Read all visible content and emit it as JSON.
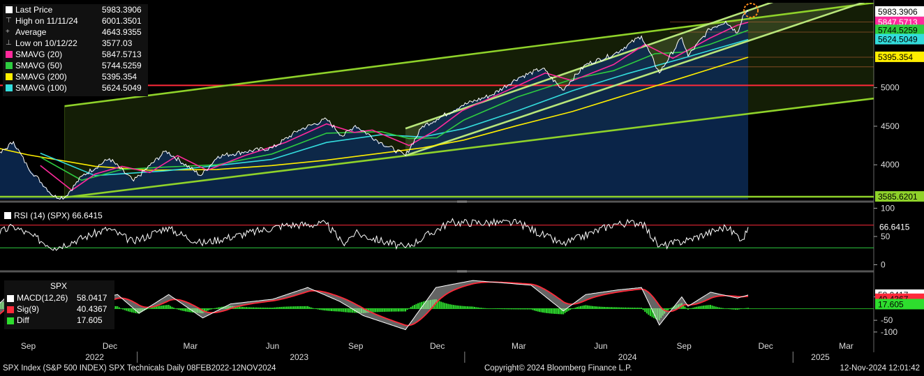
{
  "chart_data": {
    "type": "line",
    "title": "SPX Index (S&P 500 INDEX) SPX Technicals",
    "date_range": "Daily 08FEB2022-12NOV2024",
    "x_ticks": [
      "Sep",
      "Dec",
      "Mar",
      "Jun",
      "Sep",
      "Dec",
      "Mar",
      "Jun",
      "Sep",
      "Dec",
      "Mar"
    ],
    "x_years": [
      "2022",
      "2023",
      "2024",
      "2025"
    ],
    "price_panel": {
      "y_ticks": [
        "5000",
        "4500",
        "4000"
      ],
      "ylim": [
        3550,
        6100
      ],
      "legend": [
        {
          "label": "Last Price",
          "value": "5983.3906",
          "color": "#ffffff"
        },
        {
          "label": "High on 11/11/24",
          "value": "6001.3501",
          "color": "#bbbbbb"
        },
        {
          "label": "Average",
          "value": "4643.9355",
          "color": "#bbbbbb"
        },
        {
          "label": "Low on 10/12/22",
          "value": "3577.03",
          "color": "#bbbbbb"
        },
        {
          "label": "SMAVG (20)",
          "value": "5847.5713",
          "color": "#ff2a9c"
        },
        {
          "label": "SMAVG (50)",
          "value": "5744.5259",
          "color": "#2ecc40"
        },
        {
          "label": "SMAVG (200)",
          "value": "5395.354",
          "color": "#ffee00"
        },
        {
          "label": "SMAVG (100)",
          "value": "5624.5049",
          "color": "#33dddd"
        }
      ],
      "right_labels": [
        {
          "text": "5983.3906",
          "value": 5983.3906,
          "bg": "#ffffff",
          "fg": "#000000"
        },
        {
          "text": "5847.5713",
          "value": 5847.5713,
          "bg": "#ff2a9c",
          "fg": "#ffffff"
        },
        {
          "text": "5744.5259",
          "value": 5744.5259,
          "bg": "#2ecc40",
          "fg": "#000000"
        },
        {
          "text": "5624.5049",
          "value": 5624.5049,
          "bg": "#33dddd",
          "fg": "#000000"
        },
        {
          "text": "5395.354",
          "value": 5395.354,
          "bg": "#ffee00",
          "fg": "#000000"
        },
        {
          "text": "3585.6201",
          "value": 3585.6201,
          "bg": "#8fd22a",
          "fg": "#000000"
        }
      ],
      "horizontal_levels": [
        {
          "value": 5030,
          "color": "#ff2a3a"
        },
        {
          "value": 3585.6201,
          "color": "#8fd22a"
        }
      ],
      "series": [
        {
          "name": "Last Price",
          "color": "#ffffff",
          "points": [
            [
              "2022-02-08",
              4520
            ],
            [
              "2022-03-01",
              4300
            ],
            [
              "2022-04-01",
              4540
            ],
            [
              "2022-05-01",
              4150
            ],
            [
              "2022-05-20",
              3900
            ],
            [
              "2022-06-16",
              3670
            ],
            [
              "2022-07-01",
              3820
            ],
            [
              "2022-08-16",
              4300
            ],
            [
              "2022-09-01",
              3970
            ],
            [
              "2022-09-30",
              3590
            ],
            [
              "2022-10-12",
              3577
            ],
            [
              "2022-11-01",
              3860
            ],
            [
              "2022-12-01",
              4080
            ],
            [
              "2022-12-28",
              3790
            ],
            [
              "2023-01-15",
              3990
            ],
            [
              "2023-02-02",
              4180
            ],
            [
              "2023-03-13",
              3860
            ],
            [
              "2023-04-01",
              4110
            ],
            [
              "2023-05-01",
              4170
            ],
            [
              "2023-06-01",
              4220
            ],
            [
              "2023-06-30",
              4450
            ],
            [
              "2023-07-31",
              4590
            ],
            [
              "2023-08-18",
              4370
            ],
            [
              "2023-09-01",
              4510
            ],
            [
              "2023-09-29",
              4290
            ],
            [
              "2023-10-27",
              4120
            ],
            [
              "2023-11-15",
              4500
            ],
            [
              "2023-12-01",
              4590
            ],
            [
              "2023-12-29",
              4770
            ],
            [
              "2024-02-01",
              4910
            ],
            [
              "2024-03-01",
              5130
            ],
            [
              "2024-03-28",
              5250
            ],
            [
              "2024-04-19",
              4970
            ],
            [
              "2024-05-15",
              5300
            ],
            [
              "2024-06-15",
              5430
            ],
            [
              "2024-07-16",
              5670
            ],
            [
              "2024-08-05",
              5190
            ],
            [
              "2024-08-30",
              5650
            ],
            [
              "2024-09-06",
              5410
            ],
            [
              "2024-09-30",
              5760
            ],
            [
              "2024-10-18",
              5860
            ],
            [
              "2024-10-31",
              5710
            ],
            [
              "2024-11-06",
              5930
            ],
            [
              "2024-11-11",
              6001
            ],
            [
              "2024-11-12",
              5983
            ]
          ]
        },
        {
          "name": "SMAVG (20)",
          "color": "#ff2a9c",
          "points": [
            [
              "2022-09-15",
              3990
            ],
            [
              "2022-10-20",
              3670
            ],
            [
              "2022-11-15",
              3880
            ],
            [
              "2022-12-15",
              3980
            ],
            [
              "2023-01-15",
              3900
            ],
            [
              "2023-02-15",
              4120
            ],
            [
              "2023-03-20",
              3930
            ],
            [
              "2023-05-01",
              4120
            ],
            [
              "2023-06-15",
              4290
            ],
            [
              "2023-07-31",
              4530
            ],
            [
              "2023-08-31",
              4420
            ],
            [
              "2023-09-20",
              4450
            ],
            [
              "2023-10-31",
              4250
            ],
            [
              "2023-11-30",
              4450
            ],
            [
              "2023-12-29",
              4700
            ],
            [
              "2024-02-15",
              4950
            ],
            [
              "2024-03-31",
              5190
            ],
            [
              "2024-04-30",
              5090
            ],
            [
              "2024-06-15",
              5300
            ],
            [
              "2024-07-20",
              5560
            ],
            [
              "2024-08-20",
              5380
            ],
            [
              "2024-09-30",
              5640
            ],
            [
              "2024-10-31",
              5810
            ],
            [
              "2024-11-12",
              5847
            ]
          ]
        },
        {
          "name": "SMAVG (50)",
          "color": "#2ecc40",
          "points": [
            [
              "2022-09-15",
              4100
            ],
            [
              "2022-10-31",
              3800
            ],
            [
              "2022-12-15",
              3940
            ],
            [
              "2023-01-31",
              3970
            ],
            [
              "2023-03-31",
              4000
            ],
            [
              "2023-05-31",
              4140
            ],
            [
              "2023-07-31",
              4410
            ],
            [
              "2023-09-30",
              4430
            ],
            [
              "2023-10-31",
              4340
            ],
            [
              "2023-12-01",
              4350
            ],
            [
              "2023-12-31",
              4580
            ],
            [
              "2024-02-29",
              4880
            ],
            [
              "2024-04-30",
              5110
            ],
            [
              "2024-06-15",
              5220
            ],
            [
              "2024-07-31",
              5440
            ],
            [
              "2024-08-31",
              5460
            ],
            [
              "2024-09-30",
              5560
            ],
            [
              "2024-11-12",
              5744
            ]
          ]
        },
        {
          "name": "SMAVG (100)",
          "color": "#33dddd",
          "points": [
            [
              "2022-09-15",
              4150
            ],
            [
              "2022-11-15",
              3860
            ],
            [
              "2023-01-31",
              3920
            ],
            [
              "2023-03-31",
              3990
            ],
            [
              "2023-05-31",
              4070
            ],
            [
              "2023-07-31",
              4290
            ],
            [
              "2023-09-30",
              4390
            ],
            [
              "2023-11-15",
              4360
            ],
            [
              "2023-12-31",
              4470
            ],
            [
              "2024-02-29",
              4700
            ],
            [
              "2024-04-30",
              4960
            ],
            [
              "2024-06-30",
              5180
            ],
            [
              "2024-08-31",
              5380
            ],
            [
              "2024-11-12",
              5624
            ]
          ]
        },
        {
          "name": "SMAVG (200)",
          "color": "#ffee00",
          "points": [
            [
              "2022-02-08",
              4510
            ],
            [
              "2022-05-01",
              4450
            ],
            [
              "2022-07-01",
              4290
            ],
            [
              "2022-09-01",
              4130
            ],
            [
              "2022-11-15",
              3980
            ],
            [
              "2023-01-15",
              3930
            ],
            [
              "2023-03-31",
              3940
            ],
            [
              "2023-05-31",
              3990
            ],
            [
              "2023-07-31",
              4060
            ],
            [
              "2023-09-30",
              4150
            ],
            [
              "2023-11-15",
              4220
            ],
            [
              "2023-12-31",
              4320
            ],
            [
              "2024-02-29",
              4510
            ],
            [
              "2024-04-30",
              4690
            ],
            [
              "2024-06-30",
              4910
            ],
            [
              "2024-08-31",
              5130
            ],
            [
              "2024-11-12",
              5395
            ]
          ]
        }
      ],
      "trend_lines": [
        {
          "color": "#8fd22a",
          "points": [
            [
              "2022-10-12",
              4760
            ],
            [
              "2025-04-01",
              6100
            ]
          ]
        },
        {
          "color": "#8fd22a",
          "points": [
            [
              "2022-10-12",
              3577
            ],
            [
              "2025-04-01",
              4860
            ]
          ]
        },
        {
          "color": "#b8e67a",
          "points": [
            [
              "2023-10-27",
              4470
            ],
            [
              "2025-01-01",
              6200
            ]
          ]
        },
        {
          "color": "#b8e67a",
          "points": [
            [
              "2023-10-27",
              4120
            ],
            [
              "2025-04-01",
              6150
            ]
          ]
        }
      ]
    },
    "rsi_panel": {
      "label": "RSI (14) (SPX)",
      "value_text": "66.6415",
      "y_ticks": [
        "100",
        "50",
        "0"
      ],
      "ylim": [
        -8,
        108
      ],
      "overbought": 70,
      "oversold": 30,
      "points": [
        [
          "2022-02-08",
          45
        ],
        [
          "2022-04-01",
          55
        ],
        [
          "2022-06-16",
          26
        ],
        [
          "2022-08-16",
          68
        ],
        [
          "2022-10-01",
          30
        ],
        [
          "2022-11-30",
          64
        ],
        [
          "2022-12-28",
          40
        ],
        [
          "2023-02-02",
          66
        ],
        [
          "2023-03-13",
          38
        ],
        [
          "2023-06-15",
          70
        ],
        [
          "2023-07-31",
          72
        ],
        [
          "2023-08-18",
          38
        ],
        [
          "2023-09-01",
          56
        ],
        [
          "2023-10-27",
          30
        ],
        [
          "2023-12-15",
          75
        ],
        [
          "2024-03-01",
          74
        ],
        [
          "2024-04-19",
          36
        ],
        [
          "2024-06-15",
          72
        ],
        [
          "2024-07-16",
          75
        ],
        [
          "2024-08-05",
          32
        ],
        [
          "2024-09-06",
          44
        ],
        [
          "2024-10-18",
          67
        ],
        [
          "2024-11-06",
          45
        ],
        [
          "2024-11-12",
          66.6
        ]
      ]
    },
    "macd_panel": {
      "header": "SPX",
      "legend": [
        {
          "label": "MACD(12,26)",
          "value": "58.0417",
          "color": "#ffffff"
        },
        {
          "label": "Sig(9)",
          "value": "40.4367",
          "color": "#ff2a3a"
        },
        {
          "label": "Diff",
          "value": "17.605",
          "color": "#2edd2e"
        }
      ],
      "y_ticks": [
        "50",
        "-50",
        "-100"
      ],
      "ylim": [
        -130,
        150
      ],
      "right_labels": [
        {
          "text": "58.0417",
          "value": 58.0417,
          "bg": "#ffffff",
          "fg": "#000000"
        },
        {
          "text": "40.4367",
          "value": 40.4367,
          "bg": "#ff2a3a",
          "fg": "#000000"
        },
        {
          "text": "17.605",
          "value": 17.605,
          "bg": "#2edd2e",
          "fg": "#000000"
        }
      ],
      "points": [
        [
          "2022-06-15",
          -110
        ],
        [
          "2022-07-15",
          -40
        ],
        [
          "2022-08-16",
          80
        ],
        [
          "2022-09-01",
          40
        ],
        [
          "2022-10-10",
          -80
        ],
        [
          "2022-11-15",
          40
        ],
        [
          "2022-12-10",
          60
        ],
        [
          "2023-01-03",
          -20
        ],
        [
          "2023-02-05",
          60
        ],
        [
          "2023-03-15",
          -40
        ],
        [
          "2023-04-15",
          20
        ],
        [
          "2023-06-01",
          40
        ],
        [
          "2023-07-10",
          90
        ],
        [
          "2023-08-15",
          30
        ],
        [
          "2023-09-10",
          -30
        ],
        [
          "2023-10-27",
          -90
        ],
        [
          "2023-11-30",
          90
        ],
        [
          "2024-01-10",
          120
        ],
        [
          "2024-03-15",
          100
        ],
        [
          "2024-04-20",
          -10
        ],
        [
          "2024-05-15",
          60
        ],
        [
          "2024-06-20",
          80
        ],
        [
          "2024-07-16",
          90
        ],
        [
          "2024-08-05",
          -70
        ],
        [
          "2024-08-30",
          50
        ],
        [
          "2024-09-06",
          10
        ],
        [
          "2024-10-01",
          70
        ],
        [
          "2024-10-31",
          45
        ],
        [
          "2024-11-12",
          58
        ]
      ]
    }
  },
  "footer": {
    "left": "SPX Index (S&P 500 INDEX) SPX Technicals  Daily 08FEB2022-12NOV2024",
    "center": "Copyright© 2024 Bloomberg Finance L.P.",
    "right": "12-Nov-2024 12:01:42"
  }
}
